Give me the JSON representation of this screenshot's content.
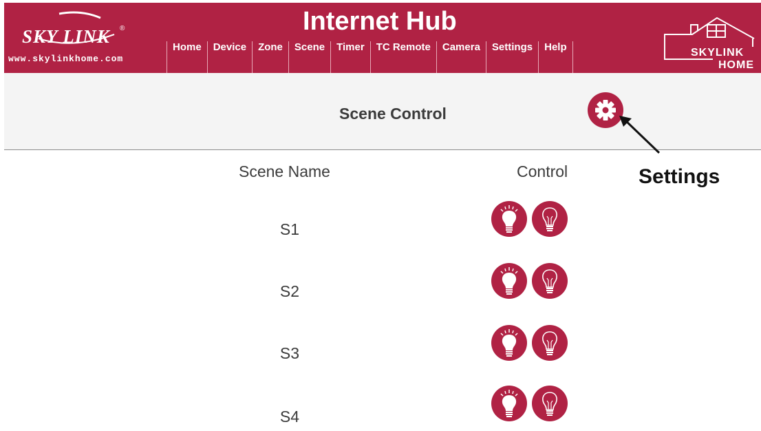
{
  "header": {
    "logo_text": "SKY LINK",
    "logo_mark": "®",
    "site_url": "www.skylinkhome.com",
    "app_title": "Internet Hub",
    "brand_line1": "SKYLINK",
    "brand_line2": "HOME",
    "accent_color": "#b02244"
  },
  "nav": [
    "Home",
    "Device",
    "Zone",
    "Scene",
    "Timer",
    "TC Remote",
    "Camera",
    "Settings",
    "Help"
  ],
  "page": {
    "title": "Scene Control",
    "settings_icon": "gear-icon"
  },
  "annotation": {
    "label": "Settings"
  },
  "table": {
    "columns": [
      "Scene Name",
      "Control"
    ],
    "rows": [
      {
        "name": "S1",
        "controls": [
          "bulb-on-icon",
          "bulb-off-icon"
        ]
      },
      {
        "name": "S2",
        "controls": [
          "bulb-on-icon",
          "bulb-off-icon"
        ]
      },
      {
        "name": "S3",
        "controls": [
          "bulb-on-icon",
          "bulb-off-icon"
        ]
      },
      {
        "name": "S4",
        "controls": [
          "bulb-on-icon",
          "bulb-off-icon"
        ]
      }
    ]
  }
}
